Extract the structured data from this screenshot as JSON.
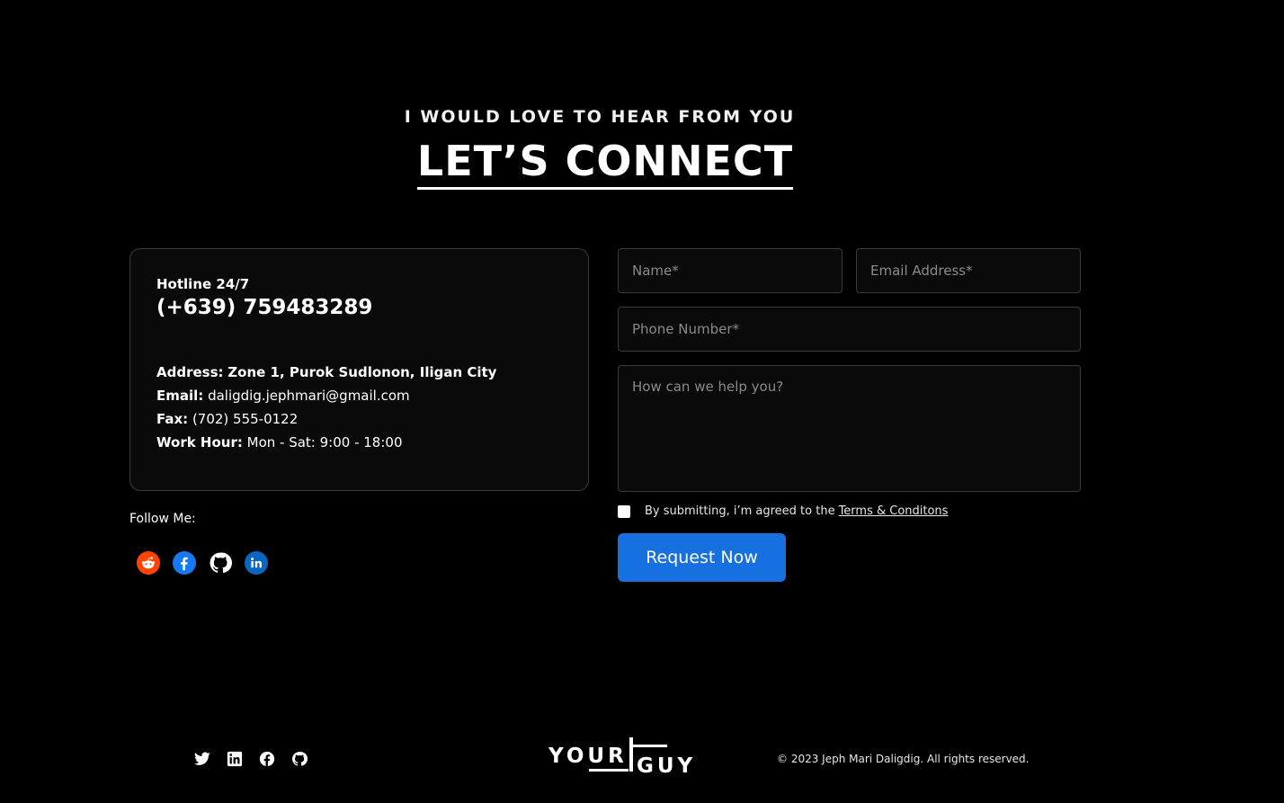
{
  "header": {
    "eyebrow": "I WOULD LOVE TO HEAR FROM YOU",
    "title": "LET’S CONNECT"
  },
  "contact_card": {
    "hotline_label": "Hotline 24/7",
    "hotline_number": "(+639) 759483289",
    "address_label": "Address:",
    "address_value": "Zone 1, Purok Sudlonon, Iligan City",
    "email_label": "Email:",
    "email_value": "daligdig.jephmari@gmail.com",
    "fax_label": "Fax:",
    "fax_value": "(702) 555-0122",
    "work_label": "Work Hour:",
    "work_value": "Mon - Sat: 9:00 - 18:00"
  },
  "follow": {
    "label": "Follow Me:",
    "icons": [
      "reddit-icon",
      "facebook-icon",
      "github-icon",
      "linkedin-icon"
    ]
  },
  "form": {
    "name_placeholder": "Name*",
    "email_placeholder": "Email Address*",
    "phone_placeholder": "Phone Number*",
    "message_placeholder": "How can we help you?",
    "agree_text": "By submitting, i’m agreed to the",
    "terms_link": "Terms & Conditons",
    "submit_label": "Request Now",
    "accent_color": "#1670e0"
  },
  "footer": {
    "icons": [
      "twitter-icon",
      "linkedin-icon",
      "facebook-icon",
      "github-icon"
    ],
    "logo_text_top": "YOUR",
    "logo_text_bottom": "GUY",
    "copyright": "© 2023 Jeph Mari Daligdig. All rights reserved."
  }
}
